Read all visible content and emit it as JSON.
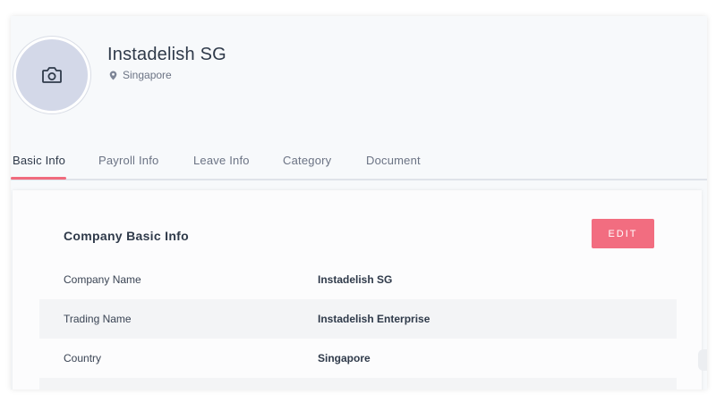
{
  "colors": {
    "accent": "#f26d80",
    "tab_underline": "#f06b7d",
    "avatar_bg": "#d3d8e8",
    "text_primary": "#2f3a4a",
    "text_secondary": "#6b7384"
  },
  "profile": {
    "name": "Instadelish SG",
    "location": "Singapore",
    "avatar_icon": "camera-icon",
    "location_icon": "map-pin-icon"
  },
  "tabs": [
    {
      "label": "Basic Info",
      "active": true
    },
    {
      "label": "Payroll Info",
      "active": false
    },
    {
      "label": "Leave Info",
      "active": false
    },
    {
      "label": "Category",
      "active": false
    },
    {
      "label": "Document",
      "active": false
    }
  ],
  "card": {
    "title": "Company Basic Info",
    "edit_label": "EDIT",
    "rows": [
      {
        "label": "Company Name",
        "value": "Instadelish SG"
      },
      {
        "label": "Trading Name",
        "value": "Instadelish Enterprise"
      },
      {
        "label": "Country",
        "value": "Singapore"
      },
      {
        "label": "",
        "value": ""
      }
    ]
  }
}
